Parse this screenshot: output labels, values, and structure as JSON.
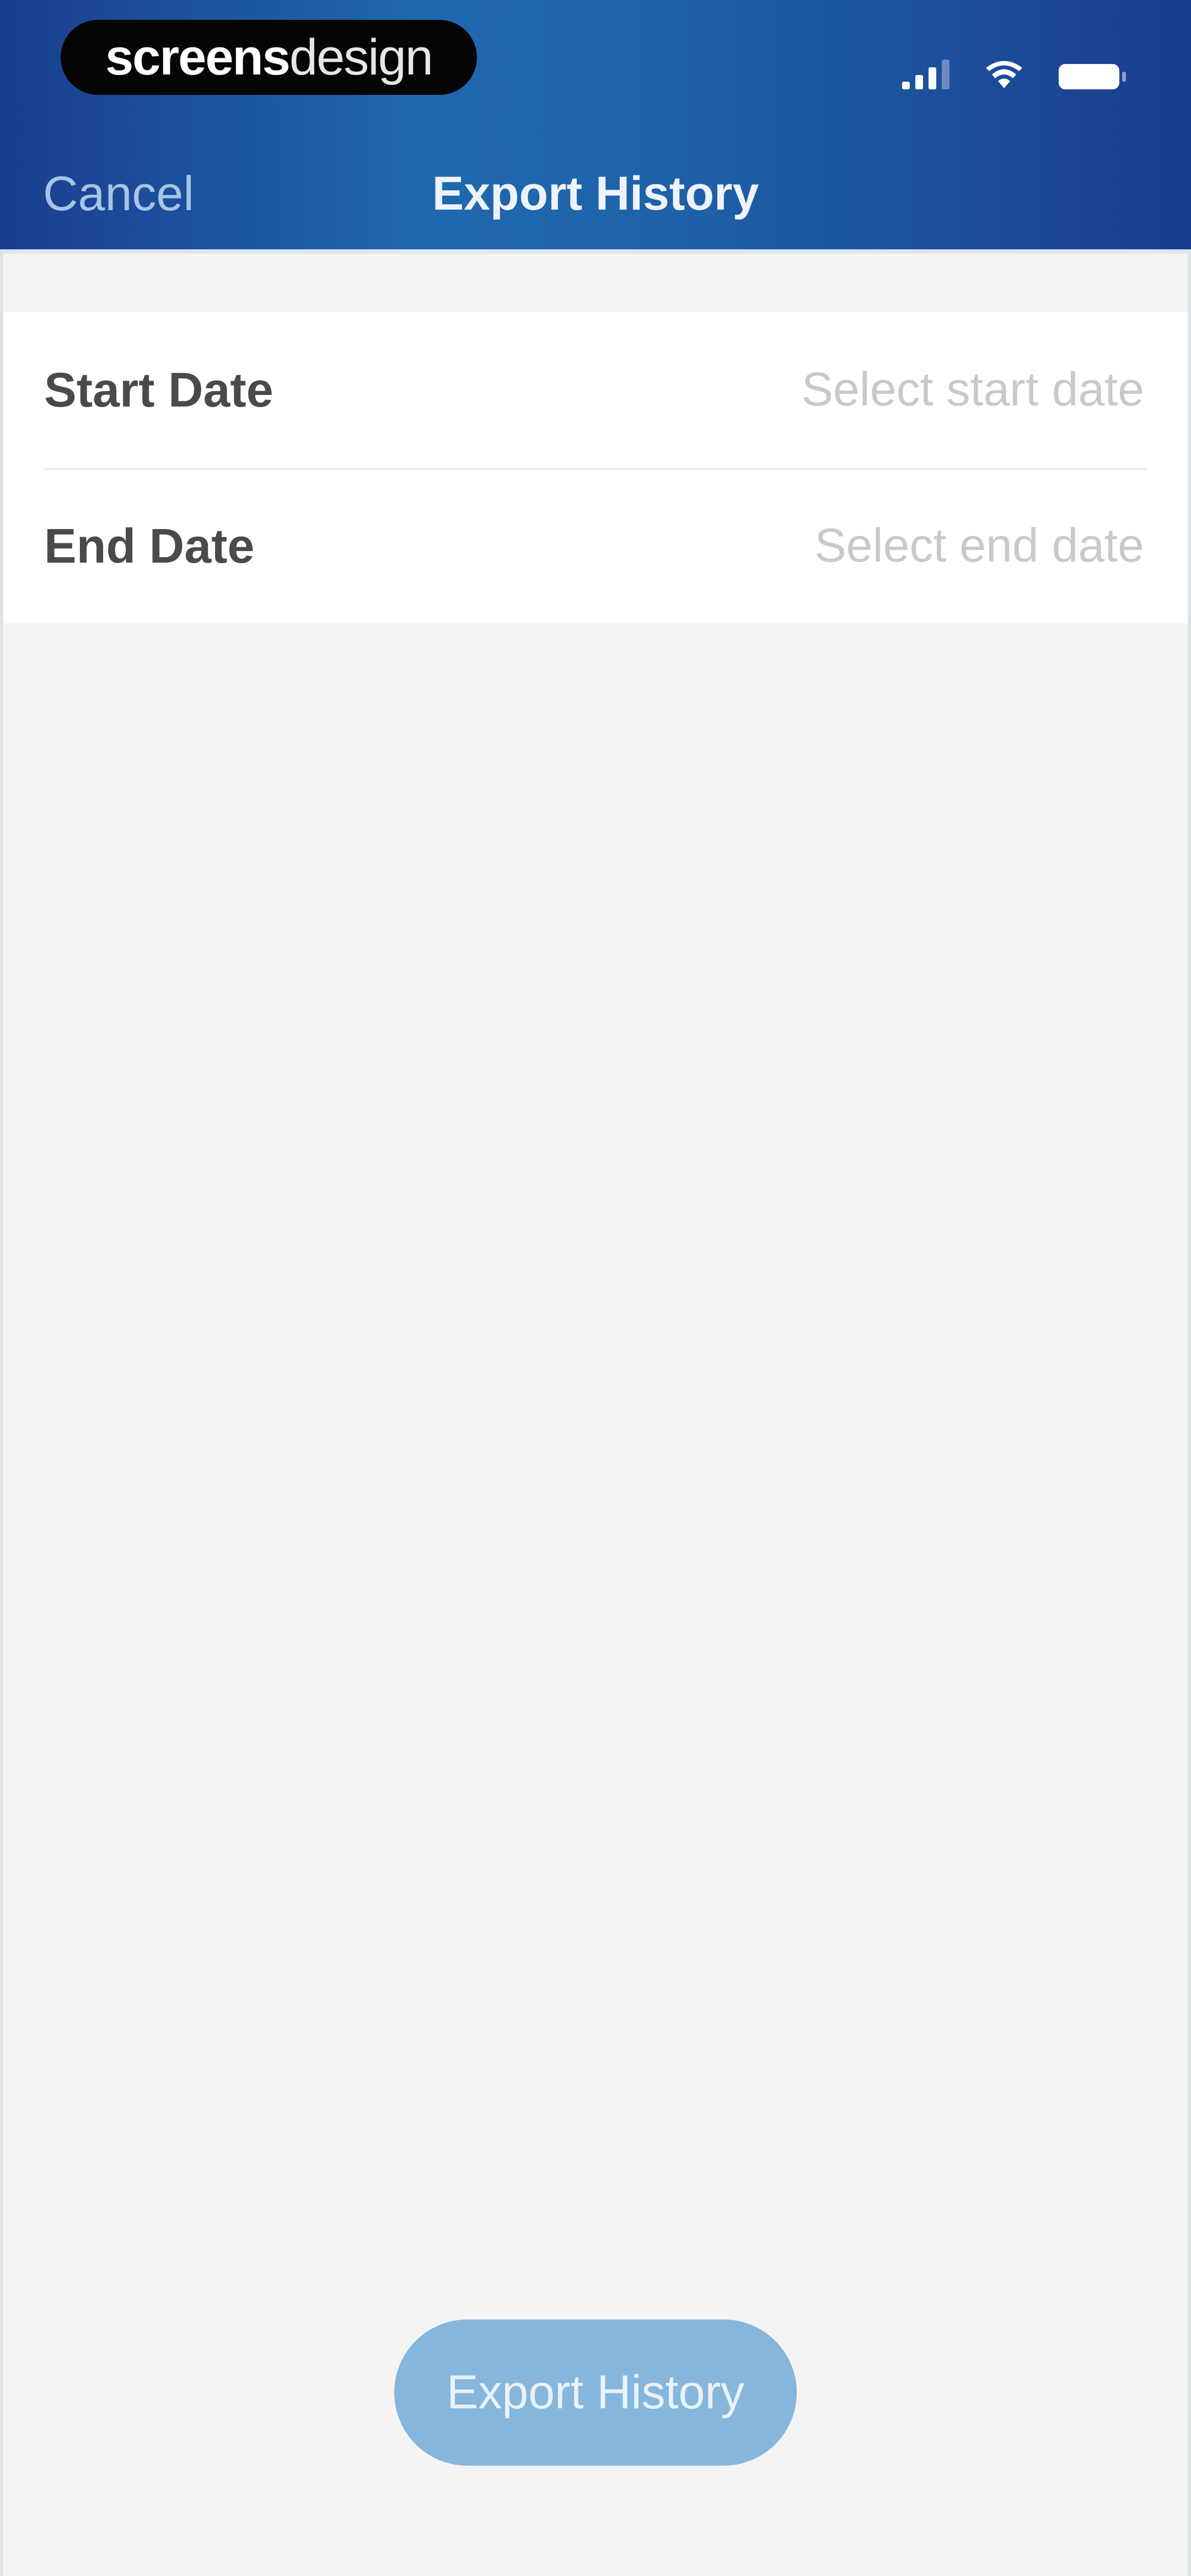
{
  "watermark": {
    "bold_text": "screens",
    "light_text": "design"
  },
  "status_bar": {
    "icons": [
      "cellular-signal-icon",
      "wifi-icon",
      "battery-icon"
    ]
  },
  "nav": {
    "cancel_label": "Cancel",
    "title": "Export History"
  },
  "form": {
    "rows": [
      {
        "label": "Start Date",
        "placeholder": "Select start date"
      },
      {
        "label": "End Date",
        "placeholder": "Select end date"
      }
    ]
  },
  "footer": {
    "export_label": "Export History"
  },
  "colors": {
    "header_gradient_dark": "#1a3d8f",
    "header_gradient_mid": "#1f68b0",
    "button_bg": "#86b6dc",
    "page_bg": "#f4f4f4"
  }
}
